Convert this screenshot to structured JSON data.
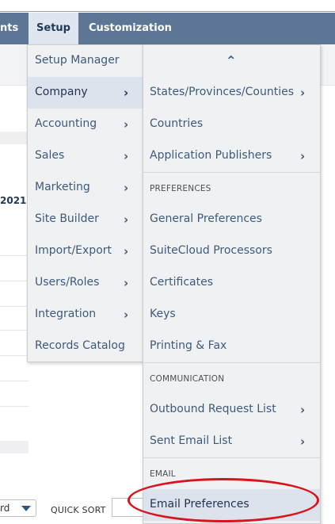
{
  "navbar": {
    "items": [
      {
        "label": "nts"
      },
      {
        "label": "Setup"
      },
      {
        "label": "Customization"
      }
    ]
  },
  "background": {
    "year_fragment": "2021",
    "dropdown_fragment": "rd",
    "quick_sort_label": "QUICK SORT"
  },
  "setup_menu": {
    "items": [
      {
        "label": "Setup Manager"
      },
      {
        "label": "Company"
      },
      {
        "label": "Accounting"
      },
      {
        "label": "Sales"
      },
      {
        "label": "Marketing"
      },
      {
        "label": "Site Builder"
      },
      {
        "label": "Import/Export"
      },
      {
        "label": "Users/Roles"
      },
      {
        "label": "Integration"
      },
      {
        "label": "Records Catalog"
      }
    ]
  },
  "company_submenu": {
    "items": [
      {
        "label": "States/Provinces/Counties"
      },
      {
        "label": "Countries"
      },
      {
        "label": "Application Publishers"
      },
      {
        "label": "General Preferences"
      },
      {
        "label": "SuiteCloud Processors"
      },
      {
        "label": "Certificates"
      },
      {
        "label": "Keys"
      },
      {
        "label": "Printing & Fax"
      },
      {
        "label": "Outbound Request List"
      },
      {
        "label": "Sent Email List"
      },
      {
        "label": "Email Preferences"
      }
    ],
    "sections": {
      "preferences": "PREFERENCES",
      "communication": "COMMUNICATION",
      "email": "EMAIL"
    }
  },
  "colors": {
    "navbar": "#5d7696",
    "menu_bg": "#f0f1f3",
    "menu_active": "#dde3ec",
    "link_text": "#3d5a7a",
    "annotation_circle": "#d9141c"
  },
  "icons": {
    "chevron": "chevron-right-icon",
    "scroll_up": "chevron-up-icon",
    "dropdown": "caret-down-icon"
  }
}
